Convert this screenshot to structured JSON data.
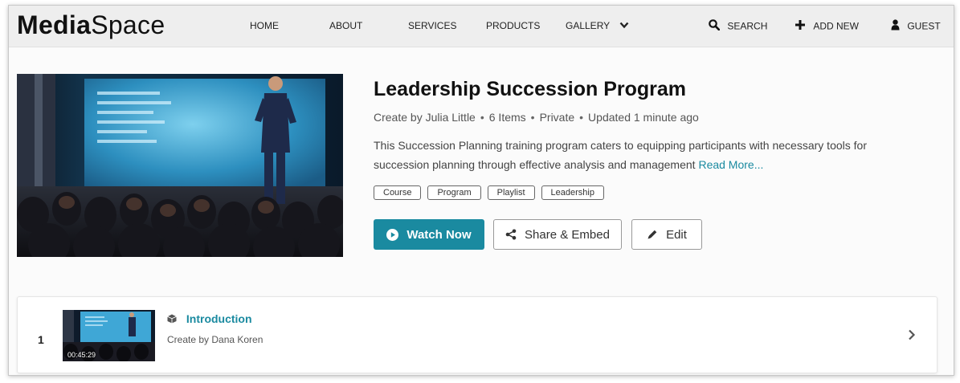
{
  "app": {
    "logo_bold": "Media",
    "logo_light": "Space"
  },
  "nav": {
    "home": "HOME",
    "about": "ABOUT",
    "services": "SERVICES",
    "products": "PRODUCTS",
    "gallery": "GALLERY",
    "search": "SEARCH",
    "add_new": "ADD NEW",
    "guest": "GUEST"
  },
  "playlist": {
    "title": "Leadership Succession Program",
    "creator": "Create by Julia Little",
    "items": "6 Items",
    "privacy": "Private",
    "updated": "Updated 1 minute ago",
    "separator": "•",
    "description": "This Succession Planning training program caters to equipping participants with necessary tools for succession planning through effective analysis and management",
    "read_more": "Read More...",
    "tags": [
      "Course",
      "Program",
      "Playlist",
      "Leadership"
    ]
  },
  "actions": {
    "watch": "Watch Now",
    "share": "Share & Embed",
    "edit": "Edit"
  },
  "entries": [
    {
      "number": "1",
      "title": "Introduction",
      "creator": "Create by Dana Koren",
      "duration": "00:45:29"
    }
  ],
  "colors": {
    "accent": "#1a8aa0",
    "navbar": "#eeeeee",
    "text": "#333333"
  },
  "icons": {
    "gallery": "chevron-down-icon",
    "search": "search-icon",
    "add": "plus-icon",
    "guest": "user-icon",
    "watch": "play-circle-icon",
    "share": "share-icon",
    "edit": "pencil-icon",
    "entry_type": "cube-icon",
    "row_open": "chevron-right-icon"
  }
}
